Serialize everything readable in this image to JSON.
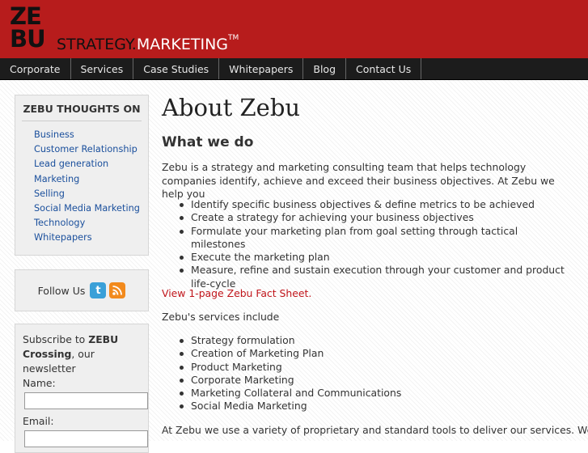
{
  "header": {
    "logo_line1": "ZE",
    "logo_line2": "BU",
    "tagline_dark": "STRATEGY.",
    "tagline_light": "MARKETING",
    "trademark": "TM",
    "brand_color": "#b71c1c"
  },
  "nav": {
    "items": [
      "Corporate",
      "Services",
      "Case Studies",
      "Whitepapers",
      "Blog",
      "Contact Us"
    ]
  },
  "sidebar": {
    "thoughts_title": "ZEBU THOUGHTS ON",
    "topics": [
      "Business",
      "Customer Relationship",
      "Lead generation",
      "Marketing",
      "Selling",
      "Social Media Marketing",
      "Technology",
      "Whitepapers"
    ],
    "follow_label": "Follow Us",
    "follow_icons": [
      "twitter-icon",
      "rss-icon"
    ],
    "newsletter": {
      "text_prefix": "Subscribe to ",
      "text_bold": "ZEBU Crossing",
      "text_suffix": ", our newsletter",
      "name_label": "Name:",
      "name_value": "",
      "email_label": "Email:",
      "email_value": ""
    }
  },
  "main": {
    "title": "About Zebu",
    "subtitle": "What we do",
    "intro": "Zebu is a strategy and marketing consulting team that helps technology companies identify, achieve and exceed their business objectives. At Zebu we help you",
    "help_items": [
      "Identify specific business objectives & define metrics to be achieved",
      "Create a strategy for achieving your business objectives",
      "Formulate your marketing plan from goal setting through tactical milestones",
      "Execute the marketing plan",
      "Measure, refine and sustain execution through your customer and product life-cycle"
    ],
    "fact_sheet_link": "View 1-page Zebu Fact Sheet.",
    "services_intro": "Zebu's services include",
    "services": [
      "Strategy formulation",
      "Creation of Marketing Plan",
      "Product Marketing",
      "Corporate Marketing",
      "Marketing Collateral and Communications",
      "Social Media Marketing"
    ],
    "closing": "At Zebu we use a variety of proprietary and standard tools to deliver our services. We"
  }
}
